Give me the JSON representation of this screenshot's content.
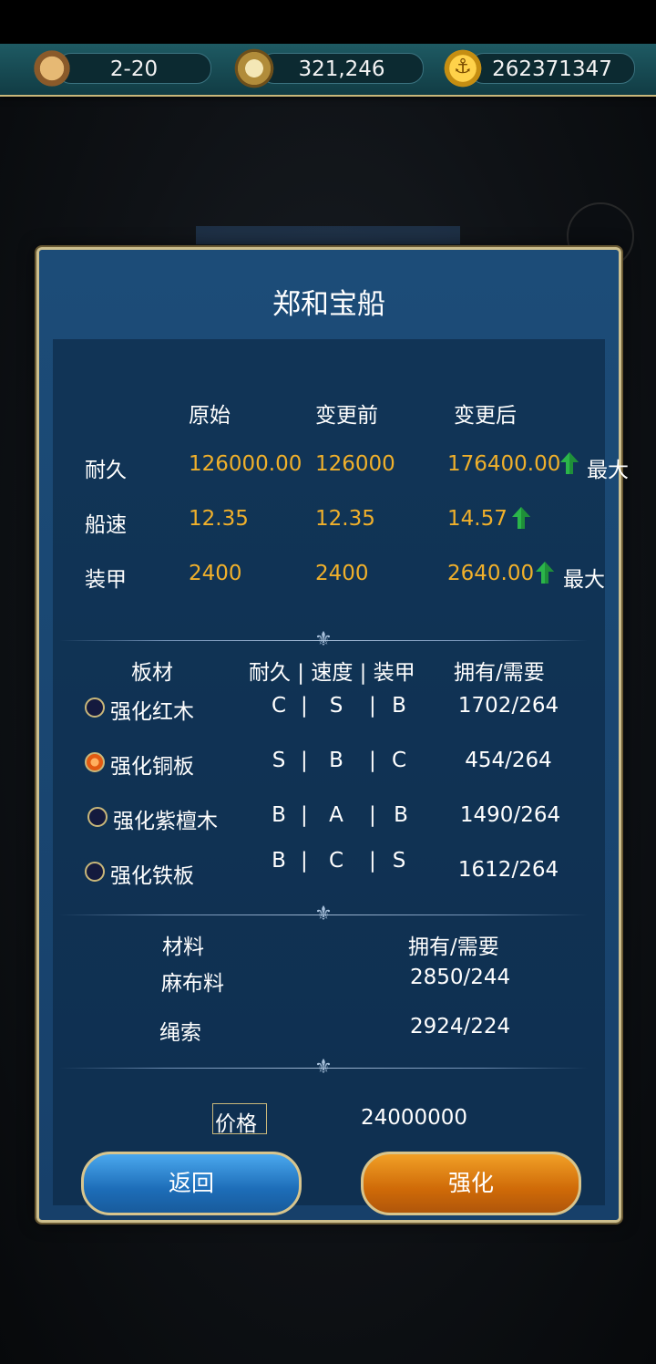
{
  "resources": {
    "stage": "2-20",
    "compass": "321,246",
    "gold": "262371347"
  },
  "panel": {
    "title": "郑和宝船",
    "stats": {
      "headers": [
        "原始",
        "变更前",
        "变更后"
      ],
      "rows": [
        {
          "name": "耐久",
          "original": "126000.00",
          "before": "126000",
          "after": "176400.00",
          "up": true,
          "max": "最大"
        },
        {
          "name": "船速",
          "original": "12.35",
          "before": "12.35",
          "after": "14.57",
          "up": true,
          "max": ""
        },
        {
          "name": "装甲",
          "original": "2400",
          "before": "2400",
          "after": "2640.00",
          "up": true,
          "max": "最大"
        }
      ]
    },
    "boards": {
      "header": {
        "name": "板材",
        "grades": "耐久 | 速度 | 装甲",
        "owned": "拥有/需要"
      },
      "rows": [
        {
          "name": "强化红木",
          "g1": "C",
          "g2": "S",
          "g3": "B",
          "owned": "1702/264",
          "selected": false
        },
        {
          "name": "强化铜板",
          "g1": "S",
          "g2": "B",
          "g3": "C",
          "owned": "454/264",
          "selected": true
        },
        {
          "name": "强化紫檀木",
          "g1": "B",
          "g2": "A",
          "g3": "B",
          "owned": "1490/264",
          "selected": false
        },
        {
          "name": "强化铁板",
          "g1": "B",
          "g2": "C",
          "g3": "S",
          "owned": "1612/264",
          "selected": false
        }
      ]
    },
    "materials": {
      "header": {
        "name": "材料",
        "owned": "拥有/需要"
      },
      "rows": [
        {
          "name": "麻布料",
          "owned": "2850/244"
        },
        {
          "name": "绳索",
          "owned": "2924/224"
        }
      ]
    },
    "price": {
      "label": "价格",
      "value": "24000000"
    },
    "buttons": {
      "back": "返回",
      "enhance": "强化"
    },
    "colors": {
      "value_gold": "#f0b02b",
      "arrow_green": "#2bb54a",
      "frame": "#cdbf8e"
    }
  }
}
